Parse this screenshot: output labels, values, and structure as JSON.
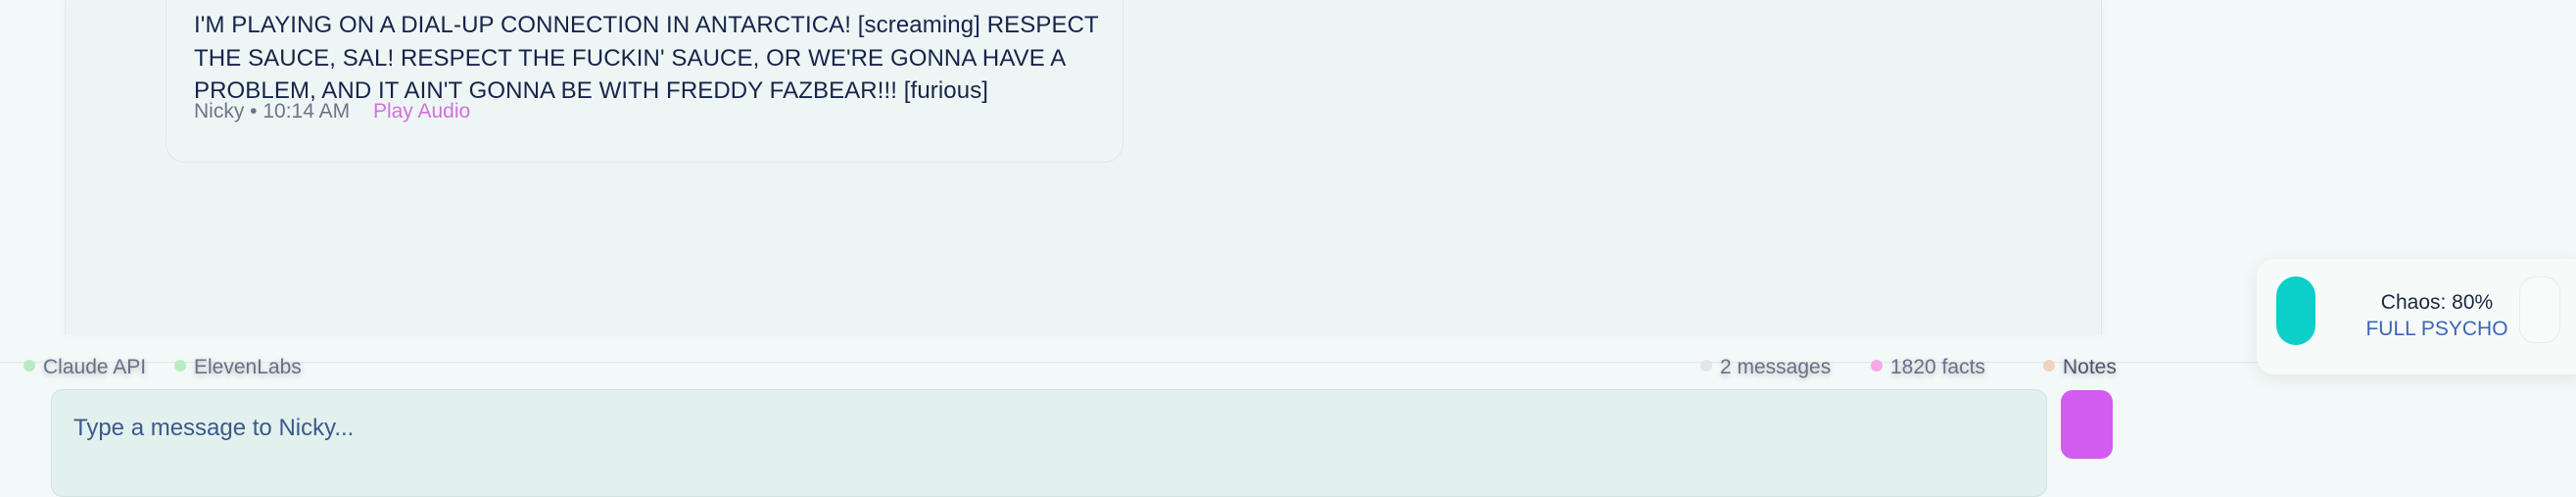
{
  "message": {
    "text": "I'M PLAYING ON A DIAL-UP CONNECTION IN ANTARCTICA! [screaming] RESPECT THE SAUCE, SAL! RESPECT THE FUCKIN' SAUCE, OR WE'RE GONNA HAVE A PROBLEM, AND IT AIN'T GONNA BE WITH FREDDY FAZBEAR!!! [furious]",
    "meta": "Nicky • 10:14 AM",
    "play_audio_label": "Play Audio"
  },
  "status_bar": {
    "claude_api": "Claude API",
    "elevenlabs": "ElevenLabs",
    "messages": "2 messages",
    "facts": "1820 facts",
    "notes": "Notes"
  },
  "input": {
    "placeholder": "Type a message to Nicky..."
  },
  "chaos": {
    "label": "Chaos: 80%",
    "level": 0.8,
    "mode": "FULL PSYCHO"
  },
  "colors": {
    "accent": "#d25cf0",
    "chaos_knob": "#0ccfca",
    "play_audio": "#d36ee0"
  }
}
